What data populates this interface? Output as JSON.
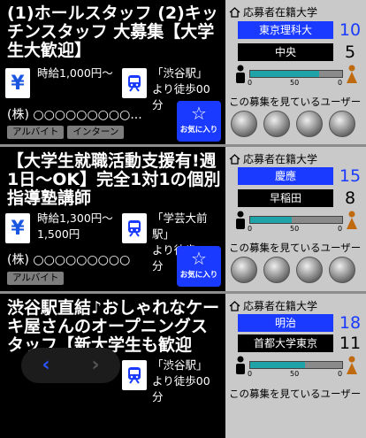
{
  "jobs": [
    {
      "title": "(1)ホールスタッフ (2)キッチンスタッフ 大募集【大学生大歓迎】",
      "salary": "時給1,000円〜",
      "station_line1": "「渋谷駅」",
      "station_line2": "より徒歩00分",
      "company": "(株) ○○○○○○○○○...",
      "tags": [
        "アルバイト",
        "インターン"
      ],
      "fav_label": "お気に入り",
      "universities": [
        {
          "name": "東京理科大",
          "count": "10"
        },
        {
          "name": "中央",
          "count": "5"
        }
      ],
      "gauge_fill": 0.75,
      "watching_label": "この募集を見ているユーザー"
    },
    {
      "title": "【大学生就職活動支援有!週1日〜OK】完全1対1の個別指導塾講師",
      "salary_line1": "時給1,300円〜",
      "salary_line2": "1,500円",
      "station_line1": "「学芸大前駅」",
      "station_line2": "より徒歩00分",
      "company": "(株) ○○○○○○○○○",
      "tags": [
        "アルバイト"
      ],
      "fav_label": "お気に入り",
      "universities": [
        {
          "name": "慶應",
          "count": "15"
        },
        {
          "name": "早稲田",
          "count": "8"
        }
      ],
      "gauge_fill": 0.45,
      "watching_label": "この募集を見ているユーザー"
    },
    {
      "title": "渋谷駅直結♪おしゃれなケーキ屋さんのオープニングスタッフ【新大学生も歓迎",
      "station_line1": "「渋谷駅」",
      "station_line2": "より徒歩00分",
      "universities": [
        {
          "name": "明治",
          "count": "18"
        },
        {
          "name": "首都大学東京",
          "count": "11"
        }
      ],
      "gauge_fill": 0.6,
      "watching_label": "この募集を見ているユーザー"
    }
  ],
  "enrolled_label": "応募者在籍大学",
  "gauge_ticks": [
    "0",
    "50",
    "0"
  ],
  "pager": {
    "prev": "‹",
    "next": "›"
  },
  "colors": {
    "accent": "#1a3bff",
    "panel": "#c9c9c9",
    "teal": "#1fa3a8"
  }
}
